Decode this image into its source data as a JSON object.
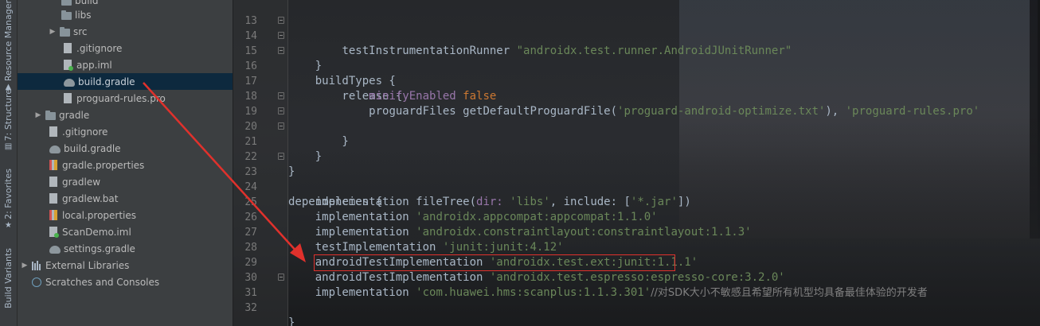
{
  "sidebar_tabs": {
    "resource_manager": "Resource Manager",
    "structure": "7: Structure",
    "favorites": "2: Favorites",
    "build_variants": "Build Variants"
  },
  "project_tree": {
    "build_partial": "build",
    "libs": "libs",
    "src": "src",
    "gitignore_app": ".gitignore",
    "app_iml": "app.iml",
    "build_gradle_app": "build.gradle",
    "proguard_rules": "proguard-rules.pro",
    "gradle": "gradle",
    "gitignore_root": ".gitignore",
    "build_gradle_root": "build.gradle",
    "gradle_properties": "gradle.properties",
    "gradlew": "gradlew",
    "gradlew_bat": "gradlew.bat",
    "local_properties": "local.properties",
    "scandemo_iml": "ScanDemo.iml",
    "settings_gradle": "settings.gradle",
    "external_libraries": "External Libraries",
    "scratches": "Scratches and Consoles"
  },
  "editor": {
    "line_numbers": [
      "13",
      "14",
      "15",
      "16",
      "17",
      "18",
      "19",
      "20",
      "21",
      "22",
      "23",
      "24",
      "25",
      "26",
      "27",
      "28",
      "29",
      "30",
      "31",
      "32"
    ],
    "l13": {
      "kw": "testInstrumentationRunner ",
      "str": "\"androidx.test.runner.AndroidJUnitRunner\""
    },
    "l14": "    }",
    "l15": "    buildTypes {",
    "l16": "        release {",
    "l17": {
      "prop": "minifyEnabled ",
      "kw": "false"
    },
    "l18": {
      "a": "proguardFiles getDefaultProguardFile(",
      "s1": "'proguard-android-optimize.txt'",
      "b": "), ",
      "s2": "'proguard-rules.pro'"
    },
    "l19": "        }",
    "l20": "    }",
    "l21": "}",
    "l23": "dependencies {",
    "l24": {
      "a": "implementation fileTree(",
      "b": "dir: ",
      "s1": "'libs'",
      "c": ", include: [",
      "s2": "'*.jar'",
      "d": "])"
    },
    "l25": {
      "a": "implementation ",
      "s": "'androidx.appcompat:appcompat:1.1.0'"
    },
    "l26": {
      "a": "implementation ",
      "s": "'androidx.constraintlayout:constraintlayout:1.1.3'"
    },
    "l27": {
      "a": "testImplementation ",
      "s": "'junit:junit:4.12'"
    },
    "l28": {
      "a": "androidTestImplementation ",
      "s": "'androidx.test.ext:junit:1.1.1'"
    },
    "l29": {
      "a": "androidTestImplementation ",
      "s": "'androidx.test.espresso:espresso-core:3.2.0'"
    },
    "l30": {
      "a": "implementation ",
      "s": "'com.huawei.hms:scanplus:1.1.3.301'",
      "comment": "//对SDK大小不敏感且希望所有机型均具备最佳体验的开发者"
    },
    "l31": "}"
  },
  "colors": {
    "keyword": "#cc7832",
    "string": "#6a8759",
    "property": "#9876aa",
    "annotation": "#e0312c",
    "selection": "#0d293e"
  }
}
